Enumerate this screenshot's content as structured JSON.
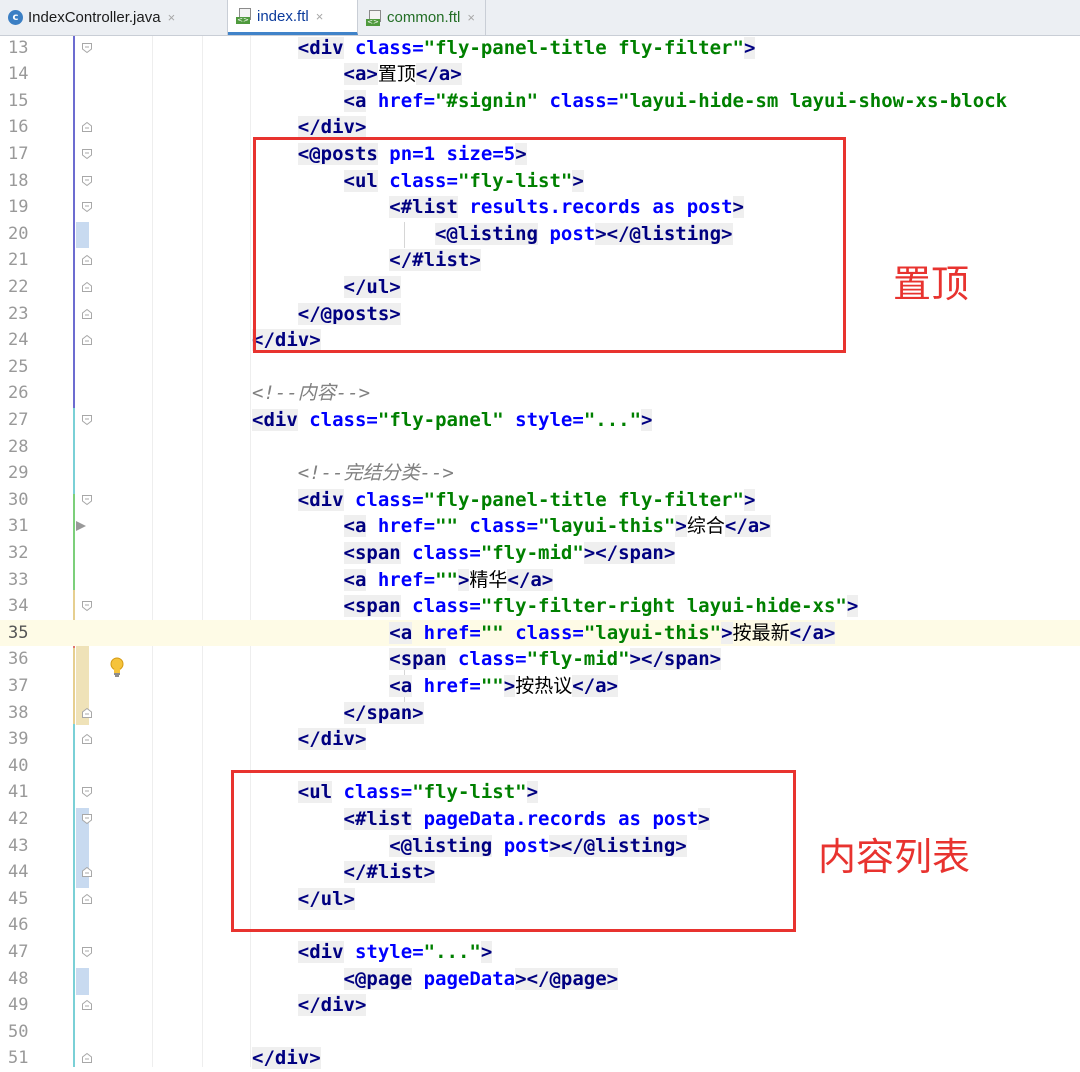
{
  "tabs": [
    {
      "label": "IndexController.java",
      "type": "java"
    },
    {
      "label": "index.ftl",
      "type": "ftl",
      "active": true
    },
    {
      "label": "common.ftl",
      "type": "ftl"
    }
  ],
  "tab_close_glyph": "×",
  "current_line": 35,
  "lines": [
    {
      "n": "13",
      "html": "    <div class=\"fly-panel-title fly-filter\">"
    },
    {
      "n": "14",
      "html": "        <a>置顶</a>"
    },
    {
      "n": "15",
      "html": "        <a href=\"#signin\" class=\"layui-hide-sm layui-show-xs-block"
    },
    {
      "n": "16",
      "html": "    </div>"
    },
    {
      "n": "17",
      "html": "    <@posts pn=1 size=5>"
    },
    {
      "n": "18",
      "html": "        <ul class=\"fly-list\">"
    },
    {
      "n": "19",
      "html": "            <#list results.records as post>"
    },
    {
      "n": "20",
      "html": "                <@listing post></@listing>"
    },
    {
      "n": "21",
      "html": "            </#list>"
    },
    {
      "n": "22",
      "html": "        </ul>"
    },
    {
      "n": "23",
      "html": "    </@posts>"
    },
    {
      "n": "24",
      "html": "</div>"
    },
    {
      "n": "25",
      "html": ""
    },
    {
      "n": "26",
      "html": "<!--内容-->"
    },
    {
      "n": "27",
      "html": "<div class=\"fly-panel\" style=\"...\">"
    },
    {
      "n": "28",
      "html": ""
    },
    {
      "n": "29",
      "html": "    <!--完结分类-->"
    },
    {
      "n": "30",
      "html": "    <div class=\"fly-panel-title fly-filter\">"
    },
    {
      "n": "31",
      "html": "        <a href=\"\" class=\"layui-this\">综合</a>"
    },
    {
      "n": "32",
      "html": "        <span class=\"fly-mid\"></span>"
    },
    {
      "n": "33",
      "html": "        <a href=\"\">精华</a>"
    },
    {
      "n": "34",
      "html": "        <span class=\"fly-filter-right layui-hide-xs\">"
    },
    {
      "n": "35",
      "html": "            <a href=\"\" class=\"layui-this\">按最新</a>"
    },
    {
      "n": "36",
      "html": "            <span class=\"fly-mid\"></span>"
    },
    {
      "n": "37",
      "html": "            <a href=\"\">按热议</a>"
    },
    {
      "n": "38",
      "html": "        </span>"
    },
    {
      "n": "39",
      "html": "    </div>"
    },
    {
      "n": "40",
      "html": ""
    },
    {
      "n": "41",
      "html": "    <ul class=\"fly-list\">"
    },
    {
      "n": "42",
      "html": "        <#list pageData.records as post>"
    },
    {
      "n": "43",
      "html": "            <@listing post></@listing>"
    },
    {
      "n": "44",
      "html": "        </#list>"
    },
    {
      "n": "45",
      "html": "    </ul>"
    },
    {
      "n": "46",
      "html": ""
    },
    {
      "n": "47",
      "html": "    <div style=\"...\">"
    },
    {
      "n": "48",
      "html": "        <@page pageData></@page>"
    },
    {
      "n": "49",
      "html": "    </div>"
    },
    {
      "n": "50",
      "html": ""
    },
    {
      "n": "51",
      "html": "</div>"
    }
  ],
  "annotations": [
    {
      "label": "置顶"
    },
    {
      "label": "内容列表"
    }
  ],
  "colors": {
    "tag": "#000080",
    "attribute": "#0000ff",
    "value": "#008000",
    "comment": "#808080",
    "annotation": "#e8332f",
    "current_line": "#fefbe6"
  }
}
